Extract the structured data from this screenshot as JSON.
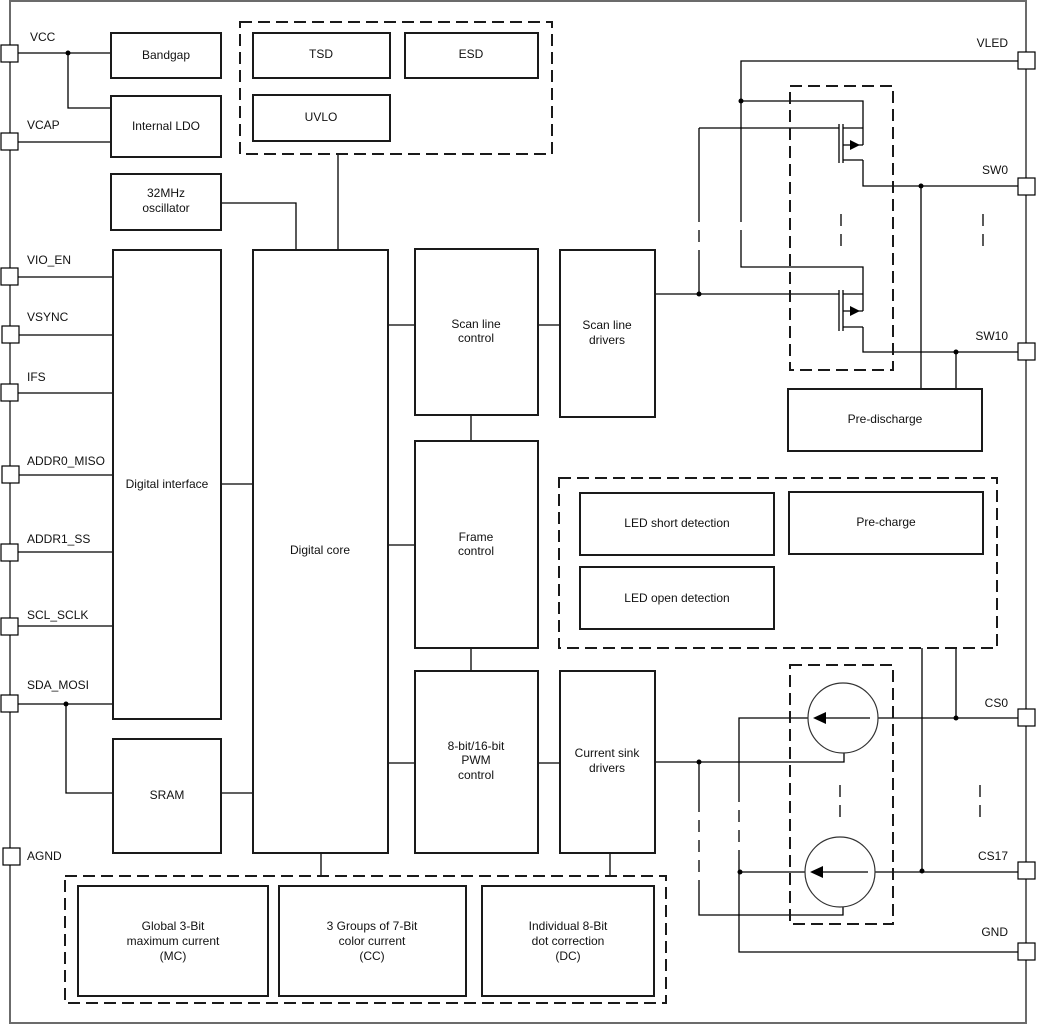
{
  "pins": {
    "left": {
      "vcc": "VCC",
      "vcap": "VCAP",
      "vio_en": "VIO_EN",
      "vsync": "VSYNC",
      "ifs": "IFS",
      "addr0_miso": "ADDR0_MISO",
      "addr1_ss": "ADDR1_SS",
      "scl_sclk": "SCL_SCLK",
      "sda_mosi": "SDA_MOSI",
      "agnd": "AGND"
    },
    "right": {
      "vled": "VLED",
      "sw0": "SW0",
      "sw10": "SW10",
      "cs0": "CS0",
      "cs17": "CS17",
      "gnd": "GND"
    }
  },
  "blocks": {
    "bandgap": [
      "Bandgap"
    ],
    "internal_ldo": [
      "Internal LDO"
    ],
    "oscillator": [
      "32MHz",
      "oscillator"
    ],
    "tsd": [
      "TSD"
    ],
    "esd": [
      "ESD"
    ],
    "uvlo": [
      "UVLO"
    ],
    "digital_interface": [
      "Digital interface"
    ],
    "digital_core": [
      "Digital core"
    ],
    "sram": [
      "SRAM"
    ],
    "scan_line_control": [
      "Scan line",
      "control"
    ],
    "scan_line_drivers": [
      "Scan line",
      "drivers"
    ],
    "frame_control": [
      "Frame",
      "control"
    ],
    "pwm_control": [
      "8-bit/16-bit",
      "PWM",
      "control"
    ],
    "current_sink_drivers": [
      "Current sink",
      "drivers"
    ],
    "pre_discharge": [
      "Pre-discharge"
    ],
    "led_short_detection": [
      "LED short detection"
    ],
    "led_open_detection": [
      "LED open detection"
    ],
    "pre_charge": [
      "Pre-charge"
    ],
    "global_mc": [
      "Global 3-Bit",
      "maximum current",
      "(MC)"
    ],
    "color_cc": [
      "3 Groups of 7-Bit",
      "color current",
      "(CC)"
    ],
    "dot_dc": [
      "Individual 8-Bit",
      "dot correction",
      "(DC)"
    ]
  },
  "symbols": {
    "switches": "PMOS scan switch array (SW0 … SW10)",
    "current_sinks": "current sink array (CS0 … CS17)"
  }
}
